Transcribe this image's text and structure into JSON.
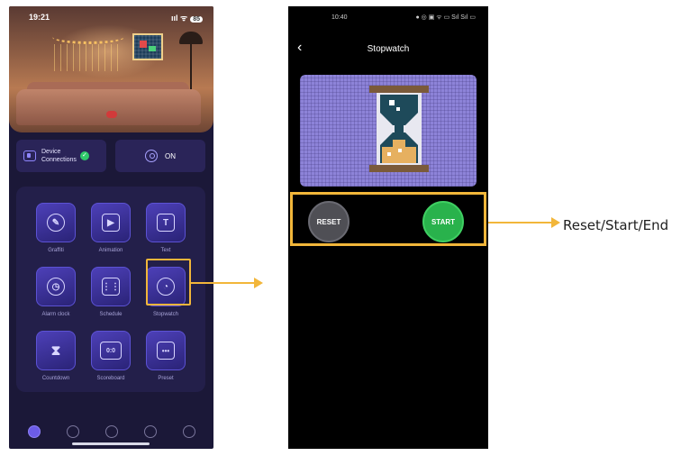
{
  "left_phone": {
    "status": {
      "time": "19:21",
      "signal": "ııl ᯤ",
      "battery": "85"
    },
    "connections": {
      "device_label_line1": "Device",
      "device_label_line2": "Connections",
      "power_label": "ON"
    },
    "features": [
      {
        "label": "Graffiti",
        "icon": "brush-icon"
      },
      {
        "label": "Animation",
        "icon": "film-icon"
      },
      {
        "label": "Text",
        "icon": "text-icon"
      },
      {
        "label": "Alarm clock",
        "icon": "alarm-clock-icon"
      },
      {
        "label": "Schedule",
        "icon": "calendar-icon"
      },
      {
        "label": "Stopwatch",
        "icon": "stopwatch-icon"
      },
      {
        "label": "Countdown",
        "icon": "hourglass-icon"
      },
      {
        "label": "Scoreboard",
        "icon": "scoreboard-icon"
      },
      {
        "label": "Preset",
        "icon": "chat-icon"
      }
    ],
    "nav": [
      "home-icon",
      "discover-icon",
      "cloud-icon",
      "music-icon",
      "settings-icon"
    ]
  },
  "right_phone": {
    "status": {
      "time": "10:40",
      "icons": "● ◎ ▣ ᯤ ▭ Sıl Sıl ▭"
    },
    "title": "Stopwatch",
    "reset_label": "RESET",
    "start_label": "START"
  },
  "callout": {
    "text": "Reset/Start/End"
  },
  "colors": {
    "highlight": "#f2b63a",
    "start_green": "#29b24c",
    "panel_purple": "#231f4a"
  }
}
